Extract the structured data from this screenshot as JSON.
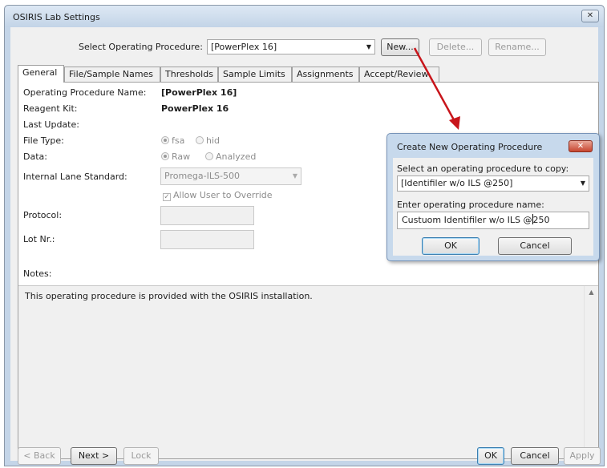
{
  "window": {
    "title": "OSIRIS Lab Settings",
    "close_glyph": "✕"
  },
  "toolbar": {
    "select_label": "Select Operating Procedure:",
    "selected_procedure": "[PowerPlex 16]",
    "new_label": "New...",
    "delete_label": "Delete...",
    "rename_label": "Rename..."
  },
  "tabs": [
    "General",
    "File/Sample Names",
    "Thresholds",
    "Sample Limits",
    "Assignments",
    "Accept/Review"
  ],
  "general": {
    "op_name_label": "Operating Procedure Name:",
    "op_name_value": "[PowerPlex 16]",
    "reagent_label": "Reagent Kit:",
    "reagent_value": "PowerPlex 16",
    "last_update_label": "Last Update:",
    "file_type_label": "File Type:",
    "file_type_options": [
      "fsa",
      "hid"
    ],
    "data_label": "Data:",
    "data_options": [
      "Raw",
      "Analyzed"
    ],
    "ils_label": "Internal Lane Standard:",
    "ils_value": "Promega-ILS-500",
    "allow_override_label": "Allow User to Override",
    "protocol_label": "Protocol:",
    "lot_label": "Lot Nr.:",
    "notes_label": "Notes:",
    "notes_text": "This operating procedure is provided with the OSIRIS installation."
  },
  "footer": {
    "back_label": "< Back",
    "next_label": "Next >",
    "lock_label": "Lock",
    "ok_label": "OK",
    "cancel_label": "Cancel",
    "apply_label": "Apply"
  },
  "dialog": {
    "title": "Create New Operating Procedure",
    "close_glyph": "✕",
    "copy_label": "Select an operating procedure to copy:",
    "copy_value": "[Identifiler w/o ILS @250]",
    "name_label": "Enter operating procedure name:",
    "name_before_caret": "Custuom Identifiler w/o ILS @",
    "name_after_caret": "250",
    "ok_label": "OK",
    "cancel_label": "Cancel"
  },
  "colors": {
    "annotation_arrow": "#c8151b",
    "window_frame": "#c4d5e8",
    "dialog_close": "#c7452f"
  }
}
